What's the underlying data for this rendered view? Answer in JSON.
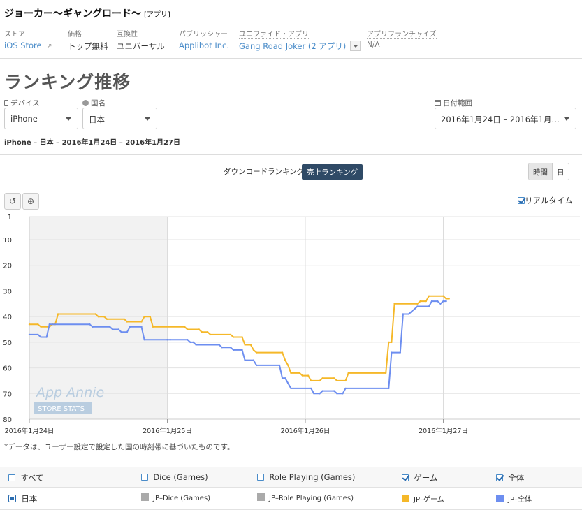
{
  "header": {
    "app_title": "ジョーカー～ギャングロード～",
    "app_tag": "[アプリ]",
    "meta": [
      {
        "label": "ストア",
        "value": "iOS Store"
      },
      {
        "label": "価格",
        "value": "トップ無料"
      },
      {
        "label": "互換性",
        "value": "ユニバーサル"
      },
      {
        "label": "パブリッシャー",
        "value": "Applibot Inc."
      },
      {
        "label": "ユニファイド・アプリ",
        "value": "Gang Road Joker (2 アプリ)"
      },
      {
        "label": "アプリフランチャイズ",
        "value": "N/A"
      }
    ]
  },
  "page_title": "ランキング推移",
  "filters": {
    "device_label": "デバイス",
    "device_value": "iPhone",
    "country_label": "国名",
    "country_value": "日本",
    "date_label": "日付範囲",
    "date_value": "2016年1月24日 – 2016年1月…"
  },
  "subtitle": "iPhone – 日本 – 2016年1月24日 – 2016年1月27日",
  "tabs": {
    "download": "ダウンロードランキング",
    "sales": "売上ランキング"
  },
  "granularity": {
    "hour": "時間",
    "day": "日"
  },
  "realtime_label": "リアルタイム",
  "watermark": {
    "brand": "App Annie",
    "sub": "STORE STATS"
  },
  "note": "*データは、ユーザー設定で設定した国の時刻帯に基づいたものです。",
  "legend": {
    "headers": [
      "すべて",
      "Dice (Games)",
      "Role Playing (Games)",
      "ゲーム",
      "全体"
    ],
    "headers_checked": [
      false,
      false,
      false,
      true,
      true
    ],
    "row_label": "日本",
    "items": [
      {
        "label": "JP–Dice (Games)",
        "color": "#aaaaaa"
      },
      {
        "label": "JP–Role Playing (Games)",
        "color": "#aaaaaa"
      },
      {
        "label": "JP–ゲーム",
        "color": "#f5b829"
      },
      {
        "label": "JP–全体",
        "color": "#6d8ef0"
      }
    ]
  },
  "chart_data": {
    "type": "line",
    "y_inverted": true,
    "ylim": [
      1,
      80
    ],
    "y_ticks": [
      1,
      10,
      20,
      30,
      40,
      50,
      60,
      70,
      80
    ],
    "x_ticks": [
      "2016年1月24日",
      "2016年1月25日",
      "2016年1月26日",
      "2016年1月27日"
    ],
    "x_unit": "hours since 2016年1月24日 00:00",
    "shaded_region_hours": [
      0,
      24
    ],
    "grid": true,
    "series": [
      {
        "name": "JP–ゲーム",
        "color": "#f5b829",
        "points": [
          [
            0,
            43
          ],
          [
            1.5,
            43
          ],
          [
            2,
            44
          ],
          [
            3.5,
            44
          ],
          [
            4,
            43
          ],
          [
            4.5,
            43
          ],
          [
            5,
            39
          ],
          [
            11.5,
            39
          ],
          [
            12,
            40
          ],
          [
            13,
            40
          ],
          [
            13.5,
            41
          ],
          [
            16.5,
            41
          ],
          [
            17,
            42
          ],
          [
            19.5,
            42
          ],
          [
            20,
            40
          ],
          [
            21,
            40
          ],
          [
            21.5,
            44
          ],
          [
            27,
            44
          ],
          [
            27.5,
            45
          ],
          [
            29.5,
            45
          ],
          [
            30,
            46
          ],
          [
            31,
            46
          ],
          [
            31.5,
            47
          ],
          [
            35,
            47
          ],
          [
            35.5,
            48
          ],
          [
            37,
            48
          ],
          [
            37.5,
            51
          ],
          [
            38.5,
            51
          ],
          [
            39,
            53
          ],
          [
            39.5,
            54
          ],
          [
            44,
            54
          ],
          [
            44.5,
            57
          ],
          [
            45,
            59
          ],
          [
            45.5,
            62
          ],
          [
            47,
            62
          ],
          [
            47.5,
            63
          ],
          [
            48.5,
            63
          ],
          [
            49,
            65
          ],
          [
            50.5,
            65
          ],
          [
            51,
            64
          ],
          [
            53,
            64
          ],
          [
            53.5,
            65
          ],
          [
            55,
            65
          ],
          [
            55.5,
            62
          ],
          [
            62,
            62
          ],
          [
            62.5,
            50
          ],
          [
            63,
            50
          ],
          [
            63.5,
            35
          ],
          [
            67.5,
            35
          ],
          [
            68,
            34
          ],
          [
            69,
            34
          ],
          [
            69.5,
            32
          ],
          [
            72,
            32
          ],
          [
            72.5,
            33
          ],
          [
            73,
            33
          ]
        ]
      },
      {
        "name": "JP–全体",
        "color": "#6d8ef0",
        "points": [
          [
            0,
            47
          ],
          [
            1.5,
            47
          ],
          [
            2,
            48
          ],
          [
            3,
            48
          ],
          [
            3.5,
            43
          ],
          [
            10.5,
            43
          ],
          [
            11,
            44
          ],
          [
            14,
            44
          ],
          [
            14.5,
            45
          ],
          [
            15.5,
            45
          ],
          [
            16,
            46
          ],
          [
            17,
            46
          ],
          [
            17.5,
            44
          ],
          [
            19.5,
            44
          ],
          [
            20,
            49
          ],
          [
            24,
            49
          ],
          [
            24.5,
            49
          ],
          [
            27.5,
            49
          ],
          [
            28,
            50
          ],
          [
            28.5,
            50
          ],
          [
            29,
            51
          ],
          [
            33,
            51
          ],
          [
            33.5,
            52
          ],
          [
            35,
            52
          ],
          [
            35.5,
            53
          ],
          [
            37,
            53
          ],
          [
            37.5,
            57
          ],
          [
            39,
            57
          ],
          [
            39.5,
            59
          ],
          [
            43.5,
            59
          ],
          [
            44,
            64
          ],
          [
            44.5,
            64
          ],
          [
            45,
            66
          ],
          [
            45.5,
            68
          ],
          [
            49,
            68
          ],
          [
            49.5,
            70
          ],
          [
            50.5,
            70
          ],
          [
            51,
            69
          ],
          [
            53,
            69
          ],
          [
            53.5,
            70
          ],
          [
            54.5,
            70
          ],
          [
            55,
            68
          ],
          [
            62.5,
            68
          ],
          [
            63,
            54
          ],
          [
            64.5,
            54
          ],
          [
            65,
            39
          ],
          [
            66,
            39
          ],
          [
            66.5,
            38
          ],
          [
            67,
            37
          ],
          [
            67.5,
            36
          ],
          [
            69.5,
            36
          ],
          [
            70,
            34
          ],
          [
            71,
            34
          ],
          [
            71.5,
            35
          ],
          [
            72,
            34
          ],
          [
            72.5,
            34
          ]
        ]
      }
    ]
  }
}
